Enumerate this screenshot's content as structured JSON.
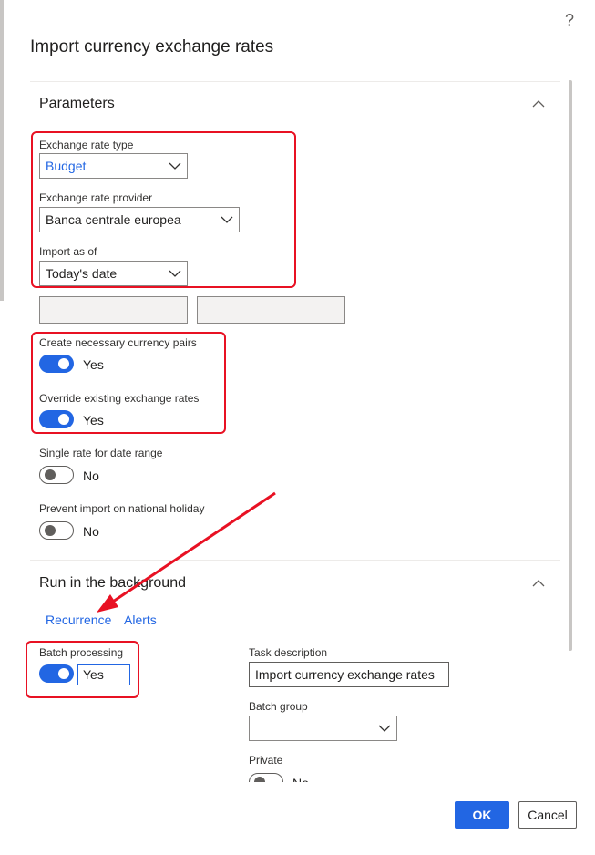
{
  "dialog": {
    "title": "Import currency exchange rates",
    "help_glyph": "?"
  },
  "parameters": {
    "section_title": "Parameters",
    "exchange_rate_type": {
      "label": "Exchange rate type",
      "value": "Budget"
    },
    "exchange_rate_provider": {
      "label": "Exchange rate provider",
      "value": "Banca centrale europea"
    },
    "import_as_of": {
      "label": "Import as of",
      "value": "Today's date"
    },
    "create_pairs": {
      "label": "Create necessary currency pairs",
      "value": "Yes",
      "on": true
    },
    "override_rates": {
      "label": "Override existing exchange rates",
      "value": "Yes",
      "on": true
    },
    "single_rate": {
      "label": "Single rate for date range",
      "value": "No",
      "on": false
    },
    "prevent_holiday": {
      "label": "Prevent import on national holiday",
      "value": "No",
      "on": false
    }
  },
  "background": {
    "section_title": "Run in the background",
    "links": {
      "recurrence": "Recurrence",
      "alerts": "Alerts"
    },
    "batch_processing": {
      "label": "Batch processing",
      "value": "Yes",
      "on": true
    },
    "task_description": {
      "label": "Task description",
      "value": "Import currency exchange rates"
    },
    "batch_group": {
      "label": "Batch group",
      "value": ""
    },
    "private": {
      "label": "Private",
      "value": "No",
      "on": false
    }
  },
  "footer": {
    "ok_label": "OK",
    "cancel_label": "Cancel"
  },
  "colors": {
    "accent": "#2266e3",
    "highlight": "#e81123"
  }
}
